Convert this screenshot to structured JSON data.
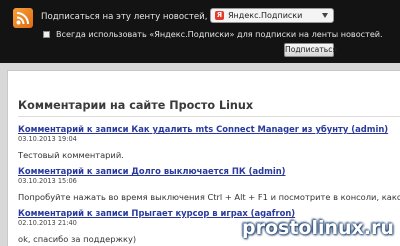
{
  "subscribe_bar": {
    "label": "Подписаться на эту ленту новостей, используя",
    "reader_value": "Яндекс.Подписки",
    "reader_icon": "yandex-icon",
    "always_use_label": "Всегда использовать «Яндекс.Подписки» для подписки на ленты новостей.",
    "always_use_checked": false,
    "subscribe_button": "Подписаться"
  },
  "comments": {
    "title": "Комментарии на сайте Просто Linux",
    "items": [
      {
        "link": "Комментарий к записи Как удалить mts Connect Manager из убунту (admin)",
        "date": "03.10.2013 19:04",
        "text": "Тестовый комментарий."
      },
      {
        "link": "Комментарий к записи Долго выключается ПК (admin)",
        "date": "03.10.2013 15:06",
        "text": "Попробуйте нажать во время выключения Ctrl + Alt + F1 и посмотрите в консоли, какой процесс тормозит"
      },
      {
        "link": "Комментарий к записи Прыгает курсор в играх (agafron)",
        "date": "02.10.2013 21:40",
        "text": "ok, спасибо за поддержку)"
      }
    ]
  },
  "watermark": "prostolinux.ru",
  "colors": {
    "bar_background": "#131313",
    "link": "#2a3a9c",
    "rss": "#f08a24"
  }
}
